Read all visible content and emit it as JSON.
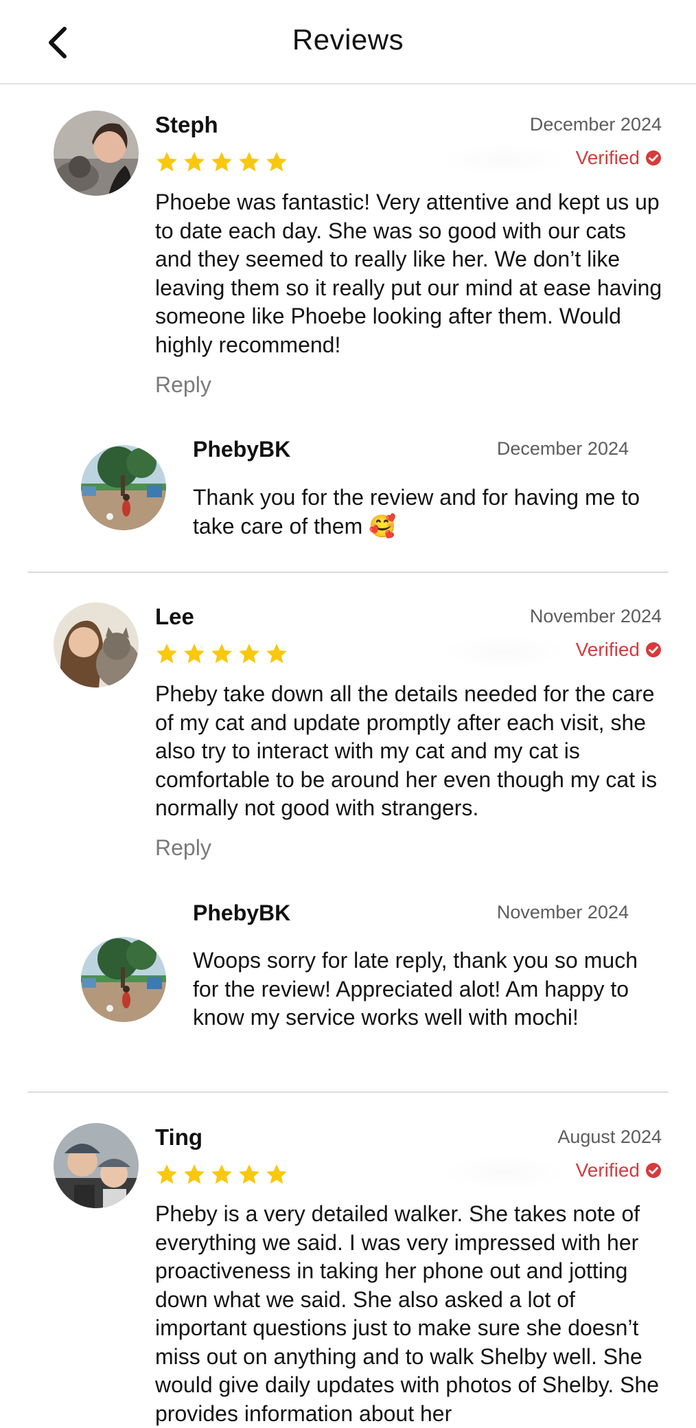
{
  "header": {
    "title": "Reviews",
    "back_icon": "chevron-left-icon"
  },
  "reviews": [
    {
      "name": "Steph",
      "date": "December 2024",
      "rating": 5,
      "verified_label": "Verified",
      "text": "Phoebe was fantastic! Very attentive and kept us up to date each day. She was so good with our cats and they seemed to really like her. We don’t like leaving them so it really put our mind at ease having someone like Phoebe looking after them. Would highly recommend!",
      "reply_label": "Reply",
      "owner_reply": {
        "name": "PhebyBK",
        "date": "December 2024",
        "text": "Thank you for the review and for having me to take care of them 🥰"
      }
    },
    {
      "name": "Lee",
      "date": "November 2024",
      "rating": 5,
      "verified_label": "Verified",
      "text": "Pheby take down all the details needed for the care of my cat and update promptly after each visit, she also try to interact with my cat and my cat is comfortable to be around her even though my cat is normally not good with strangers.",
      "reply_label": "Reply",
      "owner_reply": {
        "name": "PhebyBK",
        "date": "November 2024",
        "text": "Woops sorry for late reply, thank you so much for the review! Appreciated alot! Am happy to know my service works well with mochi!"
      }
    },
    {
      "name": "Ting",
      "date": "August 2024",
      "rating": 5,
      "verified_label": "Verified",
      "text": "Pheby is a very detailed walker. She takes note of everything we said. I was very impressed with her proactiveness in taking her phone out and jotting down what we said. She also asked a lot of important questions just to make sure she doesn’t miss out on anything and to walk Shelby well. She would give daily updates with photos of Shelby. She provides information about her"
    }
  ],
  "colors": {
    "star": "#F9C80E",
    "verified": "#D63B3B",
    "divider": "#DCDCDC"
  }
}
